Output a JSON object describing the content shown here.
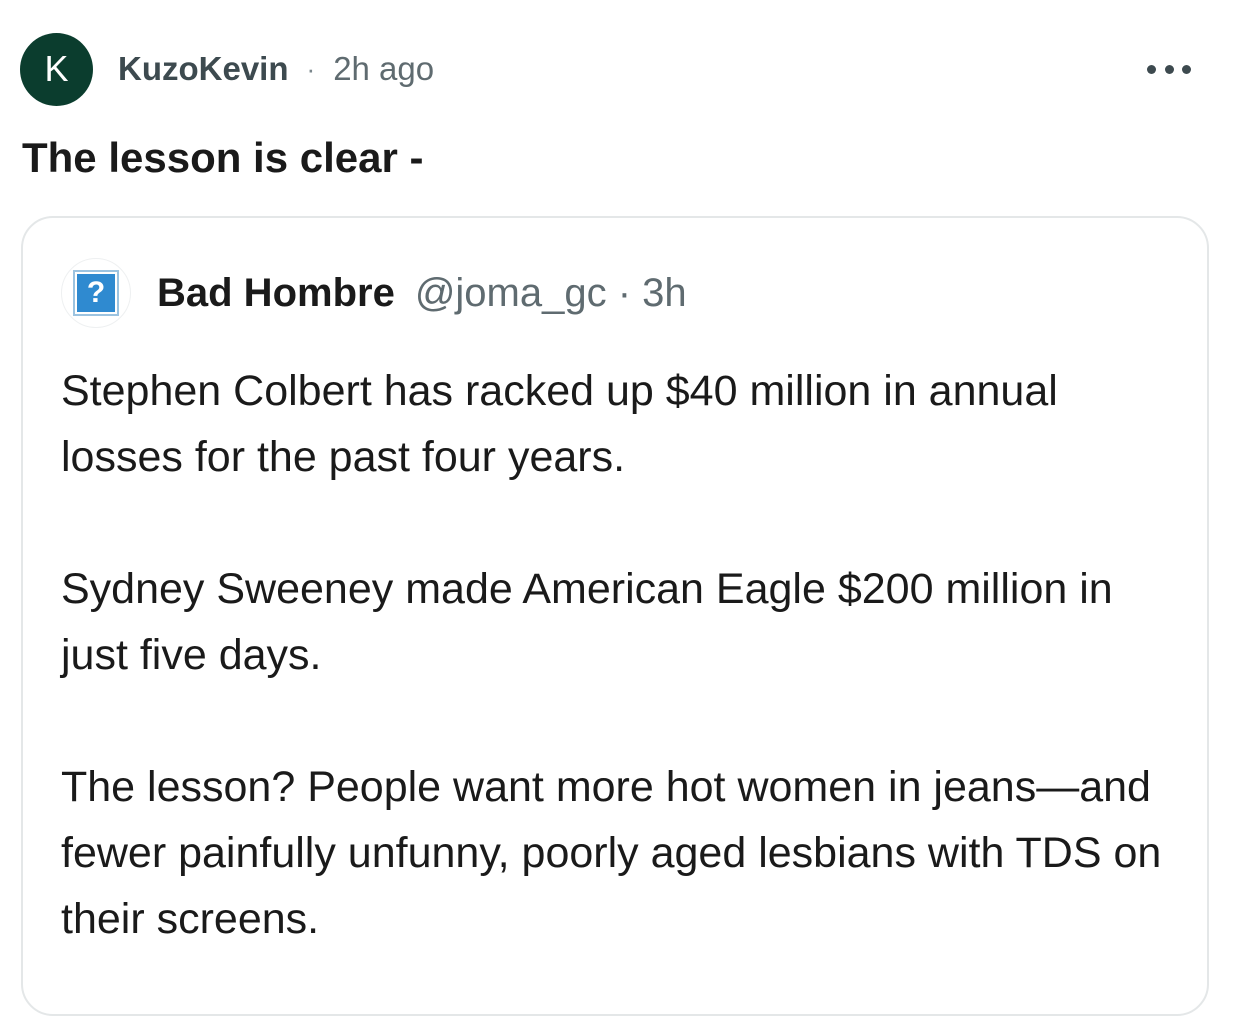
{
  "post": {
    "avatar_letter": "K",
    "avatar_color": "#0b3d2e",
    "author": "KuzoKevin",
    "separator": "·",
    "time": "2h ago",
    "more_icon": "more-horizontal-icon",
    "title": "The lesson is clear -"
  },
  "quote": {
    "avatar_icon": "question-mark-icon",
    "avatar_glyph": "?",
    "name": "Bad Hombre",
    "handle_time": "@joma_gc · 3h",
    "paragraphs": [
      "Stephen Colbert has racked up $40 million in annual losses for the past four years.",
      "Sydney Sweeney made American Eagle $200 million in just five days.",
      "The lesson? People want more hot women in jeans—and fewer painfully unfunny, poorly aged lesbians with TDS on their screens."
    ]
  }
}
